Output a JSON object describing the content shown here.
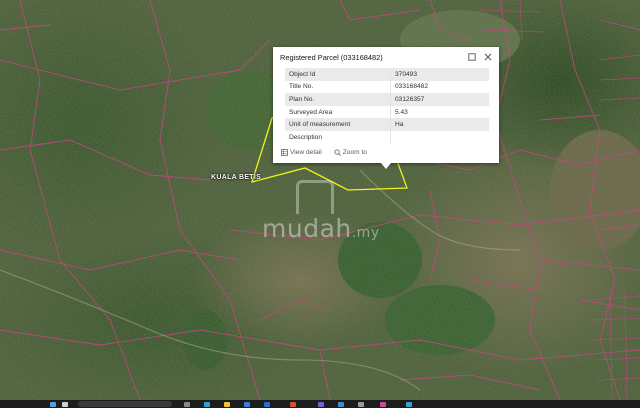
{
  "map": {
    "place_label": "KUALA BETIS",
    "watermark": {
      "brand": "mudah",
      "tld": ".my"
    },
    "colors": {
      "imagery_base": "#3d4a2e",
      "parcel_outline": "#c0487e",
      "selected_parcel": "#f2f21a"
    }
  },
  "popup": {
    "title": "Registered Parcel (033168482)",
    "maximize_icon": "maximize-icon",
    "close_icon": "close-icon",
    "rows": [
      {
        "key": "Object Id",
        "value": "370493"
      },
      {
        "key": "Title No.",
        "value": "033168482"
      },
      {
        "key": "Plan No.",
        "value": "03126357"
      },
      {
        "key": "Surveyed Area",
        "value": "5.43"
      },
      {
        "key": "Unit of measurement",
        "value": "Ha"
      },
      {
        "key": "Description",
        "value": ""
      }
    ],
    "actions": {
      "view_detail": "View detail",
      "zoom_to": "Zoom to"
    }
  },
  "taskbar": {
    "icons": [
      "windows-start-icon",
      "search-icon",
      "task-view-icon",
      "edge-icon",
      "explorer-icon",
      "store-icon",
      "mail-icon",
      "chrome-icon",
      "teams-icon",
      "photos-icon",
      "settings-icon",
      "app-icon"
    ]
  }
}
